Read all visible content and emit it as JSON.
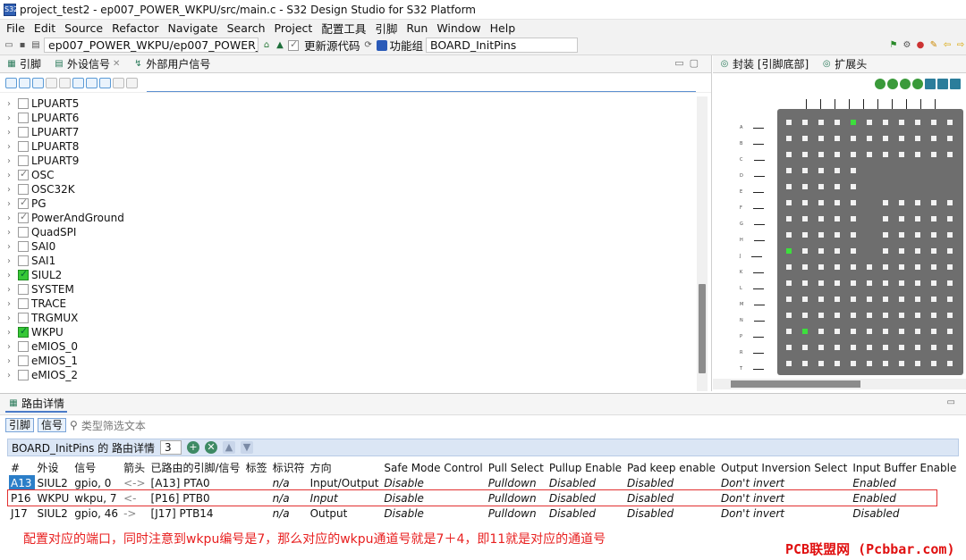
{
  "window": {
    "title": "project_test2 - ep007_POWER_WKPU/src/main.c - S32 Design Studio for S32 Platform"
  },
  "menu": [
    "File",
    "Edit",
    "Source",
    "Refactor",
    "Navigate",
    "Search",
    "Project",
    "配置工具",
    "引脚",
    "Run",
    "Window",
    "Help"
  ],
  "toolbar": {
    "project_combo": "ep007_POWER_WKPU/ep007_POWER_WKPU",
    "update_label": "更新源代码",
    "func_group_label": "功能组",
    "func_group_value": "BOARD_InitPins"
  },
  "left_tabs": [
    {
      "label": "引脚"
    },
    {
      "label": "外设信号"
    },
    {
      "label": "外部用户信号"
    }
  ],
  "tree": [
    {
      "label": "LPUART5",
      "state": "off"
    },
    {
      "label": "LPUART6",
      "state": "off"
    },
    {
      "label": "LPUART7",
      "state": "off"
    },
    {
      "label": "LPUART8",
      "state": "off"
    },
    {
      "label": "LPUART9",
      "state": "off"
    },
    {
      "label": "OSC",
      "state": "on"
    },
    {
      "label": "OSC32K",
      "state": "off"
    },
    {
      "label": "PG",
      "state": "on"
    },
    {
      "label": "PowerAndGround",
      "state": "on"
    },
    {
      "label": "QuadSPI",
      "state": "off"
    },
    {
      "label": "SAI0",
      "state": "off"
    },
    {
      "label": "SAI1",
      "state": "off"
    },
    {
      "label": "SIUL2",
      "state": "green"
    },
    {
      "label": "SYSTEM",
      "state": "off"
    },
    {
      "label": "TRACE",
      "state": "off"
    },
    {
      "label": "TRGMUX",
      "state": "off"
    },
    {
      "label": "WKPU",
      "state": "green"
    },
    {
      "label": "eMIOS_0",
      "state": "off"
    },
    {
      "label": "eMIOS_1",
      "state": "off"
    },
    {
      "label": "eMIOS_2",
      "state": "off"
    }
  ],
  "right_tabs": [
    {
      "label": "封装 [引脚底部]"
    },
    {
      "label": "扩展头"
    }
  ],
  "package": {
    "row_labels": [
      "A",
      "B",
      "C",
      "D",
      "E",
      "F",
      "G",
      "H",
      "J",
      "K",
      "L",
      "M",
      "N",
      "P",
      "R",
      "T"
    ],
    "highlight_color": "#3ddf3d"
  },
  "routing": {
    "tab_label": "路由详情",
    "sub_tabs": [
      "引脚",
      "信号"
    ],
    "filter_placeholder": "类型筛选文本",
    "header_label": "BOARD_InitPins 的 路由详情",
    "count": "3",
    "columns": [
      "#",
      "外设",
      "信号",
      "箭头",
      "已路由的引脚/信号",
      "标签",
      "标识符",
      "方向",
      "Safe Mode Control",
      "Pull Select",
      "Pullup Enable",
      "Pad keep enable",
      "Output Inversion Select",
      "Input Buffer Enable"
    ],
    "rows": [
      [
        "A13",
        "SIUL2",
        "gpio, 0",
        "<->",
        "[A13] PTA0",
        "",
        "n/a",
        "Input/Output",
        "Disable",
        "Pulldown",
        "Disabled",
        "Disabled",
        "Don't invert",
        "Enabled"
      ],
      [
        "P16",
        "WKPU",
        "wkpu, 7",
        "<-",
        "[P16] PTB0",
        "",
        "n/a",
        "Input",
        "Disable",
        "Pulldown",
        "Disabled",
        "Disabled",
        "Don't invert",
        "Enabled"
      ],
      [
        "J17",
        "SIUL2",
        "gpio, 46",
        "->",
        "[J17] PTB14",
        "",
        "n/a",
        "Output",
        "Disable",
        "Pulldown",
        "Disabled",
        "Disabled",
        "Don't invert",
        "Disabled"
      ]
    ]
  },
  "annotation": {
    "note": "配置对应的端口，同时注意到wkpu编号是7，那么对应的wkpu通道号就是7＋4，即11就是对应的通道号",
    "watermark": "PCB联盟网 (Pcbbar.com)"
  }
}
